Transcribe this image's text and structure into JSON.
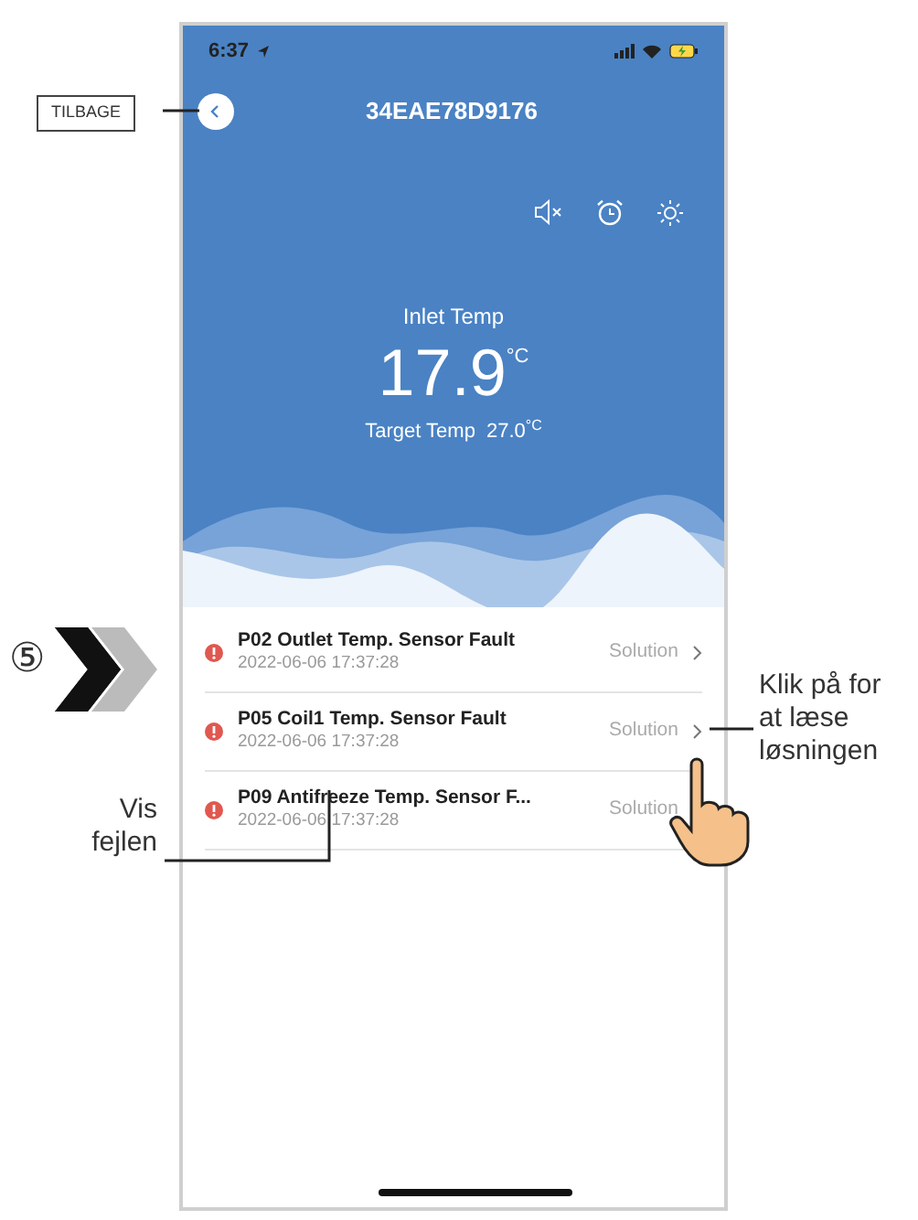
{
  "annotations": {
    "back_label": "TILBAGE",
    "step": "⑤",
    "solution_note": "Klik på for at læse løsningen",
    "fault_note": "Vis fejlen"
  },
  "status_bar": {
    "time": "6:37"
  },
  "header": {
    "title": "34EAE78D9176",
    "inlet_label": "Inlet Temp",
    "inlet_value": "17.9",
    "inlet_unit": "°C",
    "target_label": "Target Temp",
    "target_value": "27.0$^{°C}$"
  },
  "faults": [
    {
      "title": "P02 Outlet Temp. Sensor Fault",
      "time": "2022-06-06 17:37:28",
      "action": "Solution",
      "chevron": true
    },
    {
      "title": "P05 Coil1 Temp. Sensor Fault",
      "time": "2022-06-06 17:37:28",
      "action": "Solution",
      "chevron": true
    },
    {
      "title": "P09 Antifreeze Temp. Sensor F...",
      "time": "2022-06-06 17:37:28",
      "action": "Solution",
      "chevron": false
    }
  ]
}
